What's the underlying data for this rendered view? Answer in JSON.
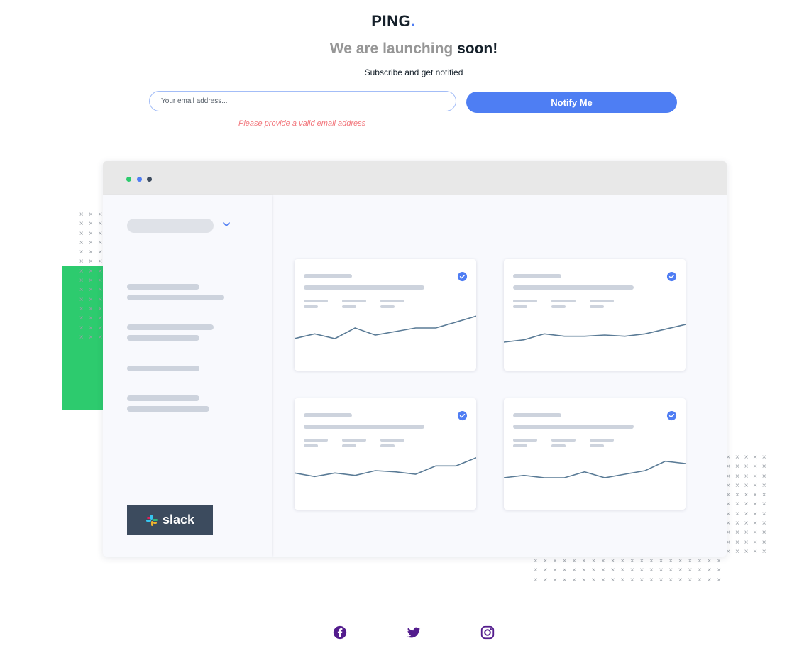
{
  "brand": {
    "name": "PING",
    "dot": "."
  },
  "hero": {
    "headline_light": "We are launching ",
    "headline_strong": "soon!",
    "subtitle": "Subscribe and get notified"
  },
  "form": {
    "email_placeholder": "Your email address...",
    "email_value": "",
    "button_label": "Notify Me",
    "error": "Please provide a valid email address"
  },
  "illustration": {
    "sidebar_badge": "slack",
    "card_count": 4,
    "charts": [
      [
        6,
        10,
        6,
        15,
        9,
        12,
        15,
        15,
        20,
        25
      ],
      [
        3,
        5,
        10,
        8,
        8,
        9,
        8,
        10,
        14,
        18
      ],
      [
        10,
        7,
        10,
        8,
        12,
        11,
        9,
        16,
        16,
        23
      ],
      [
        6,
        8,
        6,
        6,
        11,
        6,
        9,
        12,
        20,
        18
      ]
    ]
  },
  "footer": {
    "social": [
      "facebook-icon",
      "twitter-icon",
      "instagram-icon"
    ]
  },
  "colors": {
    "primary": "#4e7ef3",
    "dark": "#15202a",
    "error": "#f2747a",
    "green": "#2dcb6e",
    "purple": "#531c8d"
  }
}
